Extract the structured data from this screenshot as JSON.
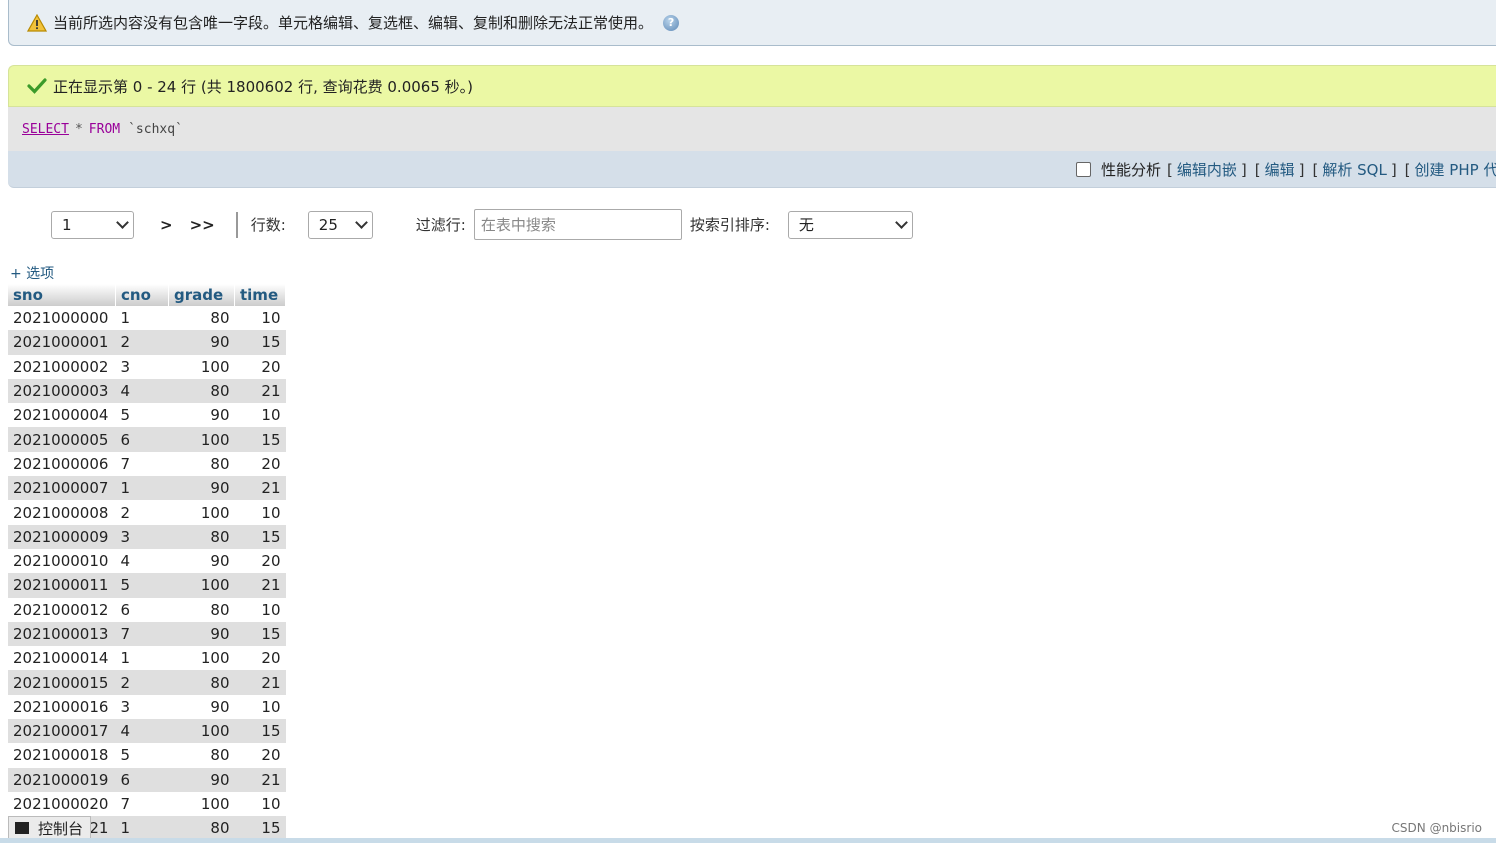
{
  "notice": {
    "text": "当前所选内容没有包含唯一字段。单元格编辑、复选框、编辑、复制和删除无法正常使用。"
  },
  "success": {
    "text": "正在显示第 0 - 24 行 (共 1800602 行, 查询花费 0.0065 秒。)"
  },
  "sql": {
    "select": "SELECT",
    "star": "*",
    "from": "FROM",
    "table": "`schxq`"
  },
  "toolbar": {
    "profiling": "性能分析",
    "links": [
      "编辑内嵌",
      "编辑",
      "解析 SQL",
      "创建 PHP 代码"
    ]
  },
  "nav": {
    "page": "1",
    "next": ">",
    "last": ">>",
    "rows_label": "行数:",
    "rows_value": "25",
    "filter_label": "过滤行:",
    "filter_placeholder": "在表中搜索",
    "sort_label": "按索引排序:",
    "sort_value": "无"
  },
  "options_link": "+ 选项",
  "table": {
    "headers": [
      "sno",
      "cno",
      "grade",
      "time"
    ],
    "rows": [
      [
        "2021000000",
        "1",
        "80",
        "10"
      ],
      [
        "2021000001",
        "2",
        "90",
        "15"
      ],
      [
        "2021000002",
        "3",
        "100",
        "20"
      ],
      [
        "2021000003",
        "4",
        "80",
        "21"
      ],
      [
        "2021000004",
        "5",
        "90",
        "10"
      ],
      [
        "2021000005",
        "6",
        "100",
        "15"
      ],
      [
        "2021000006",
        "7",
        "80",
        "20"
      ],
      [
        "2021000007",
        "1",
        "90",
        "21"
      ],
      [
        "2021000008",
        "2",
        "100",
        "10"
      ],
      [
        "2021000009",
        "3",
        "80",
        "15"
      ],
      [
        "2021000010",
        "4",
        "90",
        "20"
      ],
      [
        "2021000011",
        "5",
        "100",
        "21"
      ],
      [
        "2021000012",
        "6",
        "80",
        "10"
      ],
      [
        "2021000013",
        "7",
        "90",
        "15"
      ],
      [
        "2021000014",
        "1",
        "100",
        "20"
      ],
      [
        "2021000015",
        "2",
        "80",
        "21"
      ],
      [
        "2021000016",
        "3",
        "90",
        "10"
      ],
      [
        "2021000017",
        "4",
        "100",
        "15"
      ],
      [
        "2021000018",
        "5",
        "80",
        "20"
      ],
      [
        "2021000019",
        "6",
        "90",
        "21"
      ],
      [
        "2021000020",
        "7",
        "100",
        "10"
      ],
      [
        "2021000021",
        "1",
        "80",
        "15"
      ]
    ]
  },
  "console": {
    "label": "控制台"
  },
  "watermark": "CSDN @nbisrio",
  "colors": {
    "link": "#235a81",
    "success_bg": "#ebf8a4",
    "notice_bg": "#e8eef3"
  }
}
